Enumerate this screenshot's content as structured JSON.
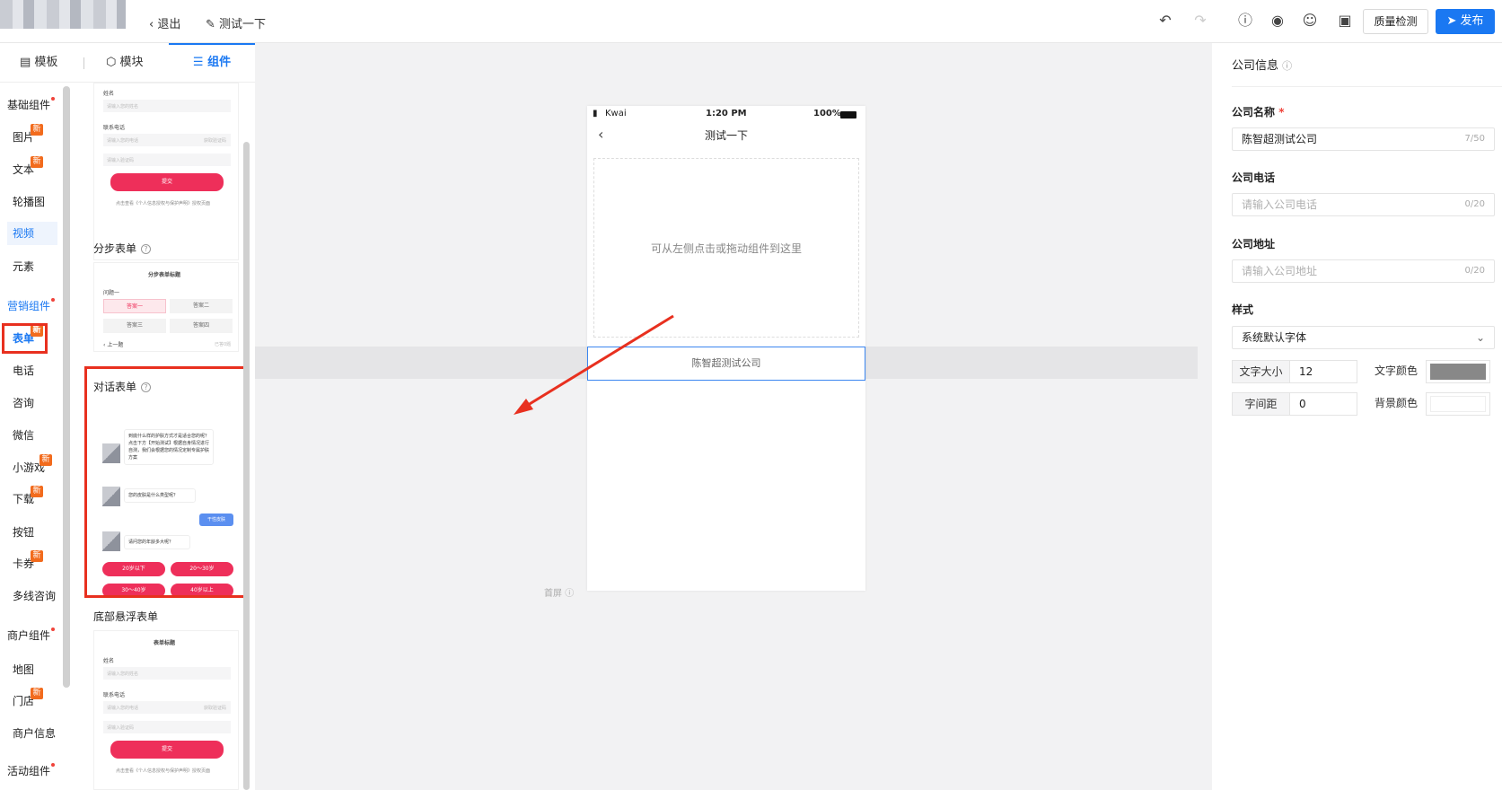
{
  "topbar": {
    "exit": "退出",
    "page_name": "测试一下",
    "quality_check": "质量检测",
    "publish": "发布"
  },
  "tabs": [
    {
      "label": "模板"
    },
    {
      "label": "模块"
    },
    {
      "label": "组件"
    }
  ],
  "categories": {
    "basic": "基础组件",
    "marketing": "营销组件",
    "merchant": "商户组件",
    "activity": "活动组件"
  },
  "items": {
    "image": "图片",
    "text": "文本",
    "carousel": "轮播图",
    "video": "视频",
    "element": "元素",
    "form": "表单",
    "phone": "电话",
    "consult": "咨询",
    "wechat": "微信",
    "minigame": "小游戏",
    "download": "下载",
    "button": "按钮",
    "coupon": "卡券",
    "multiconsult": "多线咨询",
    "map": "地图",
    "store": "门店",
    "merchant_info": "商户信息"
  },
  "new_badge": "新",
  "components": {
    "form_top": {
      "name_label": "姓名",
      "name_ph": "请输入您的姓名",
      "phone_label": "联系电话",
      "phone_ph": "请输入您的电话",
      "code_btn": "获取验证码",
      "code_ph": "请输入验证码",
      "submit": "提交",
      "agree": "点击查看《个人信息授权与保护声明》授权页面"
    },
    "step_form": {
      "title": "分步表单",
      "form_title": "分步表单标题",
      "question": "问题一",
      "answers": [
        "答案一",
        "答案二",
        "答案三",
        "答案四"
      ],
      "prev": "上一题",
      "done": "已答0题"
    },
    "chat_form": {
      "title": "对话表单",
      "msg1": "到底什么样的护肤方式才是适合您的呢？点击下方【开始测试】根据自身情况进行自测，我们会根据您的情况定制专属护肤方案",
      "msg2": "您的皮肤是什么类型呢？",
      "reply": "干性皮肤",
      "msg3": "请问您的年龄多大呢？",
      "options": [
        "20岁以下",
        "20～30岁",
        "30～40岁",
        "40岁以上"
      ]
    },
    "bottom_form": {
      "title": "底部悬浮表单",
      "form_title": "表单标题",
      "name_label": "姓名",
      "name_ph": "请输入您的姓名",
      "phone_label": "联系电话",
      "phone_ph": "请输入您的电话",
      "code_btn": "获取验证码",
      "code_ph": "请输入验证码",
      "submit": "提交",
      "agree": "点击查看《个人信息授权与保护声明》授权页面"
    }
  },
  "phone": {
    "carrier": "Kwai",
    "time": "1:20 PM",
    "battery": "100%",
    "title": "测试一下",
    "drop_hint": "可从左侧点击或拖动组件到这里",
    "selected_text": "陈智超测试公司",
    "fold_label": "首屏"
  },
  "right": {
    "section": "公司信息",
    "company_name_label": "公司名称",
    "company_name_value": "陈智超测试公司",
    "company_name_count": "7/50",
    "company_phone_label": "公司电话",
    "company_phone_ph": "请输入公司电话",
    "company_phone_count": "0/20",
    "company_addr_label": "公司地址",
    "company_addr_ph": "请输入公司地址",
    "company_addr_count": "0/20",
    "style_label": "样式",
    "font_select": "系统默认字体",
    "font_size_label": "文字大小",
    "font_size": "12",
    "text_color_label": "文字颜色",
    "letter_spacing_label": "字间距",
    "letter_spacing": "0",
    "bg_color_label": "背景颜色"
  },
  "colors": {
    "accent": "#1a78f2",
    "form_button": "#ee2f5a",
    "highlight_box": "#e8301f",
    "text_color_swatch": "#888888",
    "bg_color_swatch": "#ffffff"
  }
}
